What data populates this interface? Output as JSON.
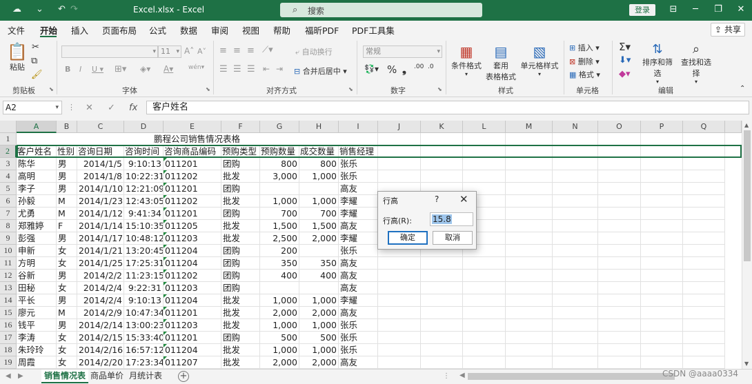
{
  "titlebar": {
    "quick_access": [
      "☁",
      "↶",
      "↷",
      "⌄"
    ],
    "title": "Excel.xlsx  -  Excel",
    "search_placeholder": "搜索",
    "login": "登录",
    "window_buttons": [
      "⊟",
      "─",
      "❐",
      "✕"
    ]
  },
  "menu": {
    "items": [
      "文件",
      "开始",
      "插入",
      "页面布局",
      "公式",
      "数据",
      "审阅",
      "视图",
      "帮助",
      "福昕PDF",
      "PDF工具集"
    ],
    "active": "开始",
    "share": "共享"
  },
  "ribbon": {
    "clipboard": {
      "label": "剪贴板",
      "paste": "粘贴"
    },
    "font": {
      "label": "字体",
      "font_name": "",
      "font_size": "11"
    },
    "alignment": {
      "label": "对齐方式",
      "wrap": "自动换行",
      "merge": "合并后居中"
    },
    "number": {
      "label": "数字",
      "format": "常规"
    },
    "styles": {
      "label": "样式",
      "conditional": "条件格式",
      "table_l1": "套用",
      "table_l2": "表格格式",
      "cell_styles": "单元格样式"
    },
    "cells": {
      "label": "单元格",
      "insert": "插入",
      "delete": "删除",
      "format": "格式"
    },
    "editing": {
      "label": "编辑",
      "sort": "排序和筛选",
      "find": "查找和选择"
    }
  },
  "formula_bar": {
    "name_box": "A2",
    "formula": "客户姓名"
  },
  "grid": {
    "columns": [
      "A",
      "B",
      "C",
      "D",
      "E",
      "F",
      "G",
      "H",
      "I",
      "J",
      "K",
      "L",
      "M",
      "N",
      "O",
      "P",
      "Q"
    ],
    "selected_column": "A",
    "selected_row": "2",
    "title_row": "鹏程公司销售情况表格",
    "headers": [
      "客户姓名",
      "性别",
      "咨询日期",
      "咨询时间",
      "咨询商品编码",
      "预购类型",
      "预购数量",
      "成交数量",
      "销售经理"
    ],
    "rows": [
      [
        "陈华",
        "男",
        "2014/1/5",
        "9:10:13",
        "011201",
        "团购",
        "800",
        "800",
        "张乐"
      ],
      [
        "高明",
        "男",
        "2014/1/8",
        "10:22:31",
        "011202",
        "批发",
        "3,000",
        "1,000",
        "张乐"
      ],
      [
        "李子",
        "男",
        "2014/1/10",
        "12:21:09",
        "011201",
        "团购",
        "",
        "",
        "高友"
      ],
      [
        "孙毅",
        "M",
        "2014/1/23",
        "12:43:05",
        "011202",
        "批发",
        "1,000",
        "1,000",
        "李耀"
      ],
      [
        "尤勇",
        "M",
        "2014/1/12",
        "9:41:34",
        "011201",
        "团购",
        "700",
        "700",
        "李耀"
      ],
      [
        "郑雅婷",
        "F",
        "2014/1/14",
        "15:10:35",
        "011205",
        "批发",
        "1,500",
        "1,500",
        "高友"
      ],
      [
        "彭强",
        "男",
        "2014/1/17",
        "10:48:12",
        "011203",
        "批发",
        "2,500",
        "2,000",
        "李耀"
      ],
      [
        "申新",
        "女",
        "2014/1/21",
        "13:20:45",
        "011204",
        "团购",
        "200",
        "",
        "张乐"
      ],
      [
        "方明",
        "女",
        "2014/1/25",
        "17:25:31",
        "011204",
        "团购",
        "350",
        "350",
        "高友"
      ],
      [
        "谷新",
        "男",
        "2014/2/2",
        "11:23:15",
        "011202",
        "团购",
        "400",
        "400",
        "高友"
      ],
      [
        "田秘",
        "女",
        "2014/2/4",
        "9:22:31",
        "011203",
        "团购",
        "",
        "",
        "高友"
      ],
      [
        "平长",
        "男",
        "2014/2/4",
        "9:10:13",
        "011204",
        "批发",
        "1,000",
        "1,000",
        "李耀"
      ],
      [
        "廖元",
        "M",
        "2014/2/9",
        "10:47:34",
        "011201",
        "批发",
        "2,000",
        "2,000",
        "高友"
      ],
      [
        "钱平",
        "男",
        "2014/2/14",
        "13:00:23",
        "011203",
        "批发",
        "1,000",
        "1,000",
        "张乐"
      ],
      [
        "李涛",
        "女",
        "2014/2/15",
        "15:33:40",
        "011201",
        "团购",
        "500",
        "500",
        "张乐"
      ],
      [
        "朱玲玲",
        "女",
        "2014/2/16",
        "16:57:12",
        "011204",
        "批发",
        "1,000",
        "1,000",
        "张乐"
      ],
      [
        "周霞",
        "女",
        "2014/2/20",
        "17:23:34",
        "011207",
        "批发",
        "2,000",
        "2,000",
        "高友"
      ]
    ]
  },
  "sheets": {
    "tabs": [
      "销售情况表",
      "商品单价",
      "月统计表"
    ],
    "active": "销售情况表"
  },
  "dialog": {
    "title": "行高",
    "help": "?",
    "field_label": "行高(R):",
    "value": "15.8",
    "ok": "确定",
    "cancel": "取消"
  },
  "watermark": "CSDN @aaaa0334"
}
